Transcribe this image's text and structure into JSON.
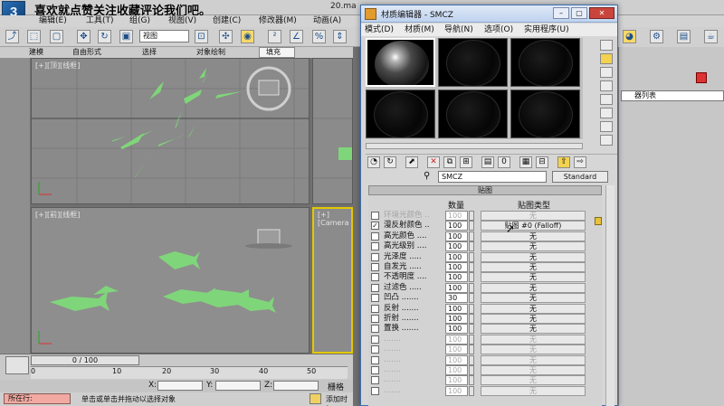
{
  "app": {
    "banner": "喜欢就点赞关注收藏评论我们吧。",
    "file_name": "20.ma",
    "logo_glyph": "3",
    "menu": [
      "编辑(E)",
      "工具(T)",
      "组(G)",
      "视图(V)",
      "创建(C)",
      "修改器(M)",
      "动画(A)"
    ],
    "viewport_selector": "视图",
    "tabs": [
      "建模",
      "自由形式",
      "选择",
      "对象绘制",
      "填充"
    ],
    "viewports": {
      "top_label": "[+][顶][线框]",
      "front_label": "[+][前][线框]",
      "camera_label": "[+][Camera"
    },
    "timeline": {
      "slider": "0 / 100",
      "ticks": [
        "0",
        "10",
        "20",
        "30",
        "40",
        "50"
      ]
    },
    "coords": {
      "x_label": "X:",
      "y_label": "Y:",
      "z_label": "Z:",
      "grid_label": "栅格"
    },
    "status": {
      "location": "所在行:",
      "hint": "单击或单击并拖动以选择对象",
      "add_tag": "添加时标"
    },
    "command_panel": {
      "list_label": "器列表"
    }
  },
  "material_editor": {
    "title": "材质编辑器 - SMCZ",
    "menu": [
      "模式(D)",
      "材质(M)",
      "导航(N)",
      "选项(O)",
      "实用程序(U)"
    ],
    "material_name": "SMCZ",
    "material_type": "Standard",
    "rollout_title": "贴图",
    "col_amount": "数量",
    "col_map_type": "贴图类型",
    "rows": [
      {
        "label": "环境光颜色 ..",
        "amount": "100",
        "map": "无",
        "checked": false,
        "disabled": true
      },
      {
        "label": "漫反射颜色 ..",
        "amount": "100",
        "map": "贴图 #0 (Falloff)",
        "checked": true,
        "disabled": false
      },
      {
        "label": "高光颜色 ....",
        "amount": "100",
        "map": "无",
        "checked": false,
        "disabled": false
      },
      {
        "label": "高光级别 ....",
        "amount": "100",
        "map": "无",
        "checked": false,
        "disabled": false
      },
      {
        "label": "光泽度 .....",
        "amount": "100",
        "map": "无",
        "checked": false,
        "disabled": false
      },
      {
        "label": "自发光 .....",
        "amount": "100",
        "map": "无",
        "checked": false,
        "disabled": false
      },
      {
        "label": "不透明度 ....",
        "amount": "100",
        "map": "无",
        "checked": false,
        "disabled": false
      },
      {
        "label": "过滤色 .....",
        "amount": "100",
        "map": "无",
        "checked": false,
        "disabled": false
      },
      {
        "label": "凹凸 .......",
        "amount": "30",
        "map": "无",
        "checked": false,
        "disabled": false
      },
      {
        "label": "反射 .......",
        "amount": "100",
        "map": "无",
        "checked": false,
        "disabled": false
      },
      {
        "label": "折射 .......",
        "amount": "100",
        "map": "无",
        "checked": false,
        "disabled": false
      },
      {
        "label": "置换 .......",
        "amount": "100",
        "map": "无",
        "checked": false,
        "disabled": false
      },
      {
        "label": ".......",
        "amount": "100",
        "map": "无",
        "checked": false,
        "disabled": true
      },
      {
        "label": ".......",
        "amount": "100",
        "map": "无",
        "checked": false,
        "disabled": true
      },
      {
        "label": ".......",
        "amount": "100",
        "map": "无",
        "checked": false,
        "disabled": true
      },
      {
        "label": ".......",
        "amount": "100",
        "map": "无",
        "checked": false,
        "disabled": true
      },
      {
        "label": ".......",
        "amount": "100",
        "map": "无",
        "checked": false,
        "disabled": true
      },
      {
        "label": ".......",
        "amount": "100",
        "map": "无",
        "checked": false,
        "disabled": true
      }
    ]
  },
  "colors": {
    "fish": "#7fd67a",
    "viewport_bg": "#8a8a8a",
    "active_viewport": "#e3c800",
    "title_blue": "#3d6fae"
  }
}
